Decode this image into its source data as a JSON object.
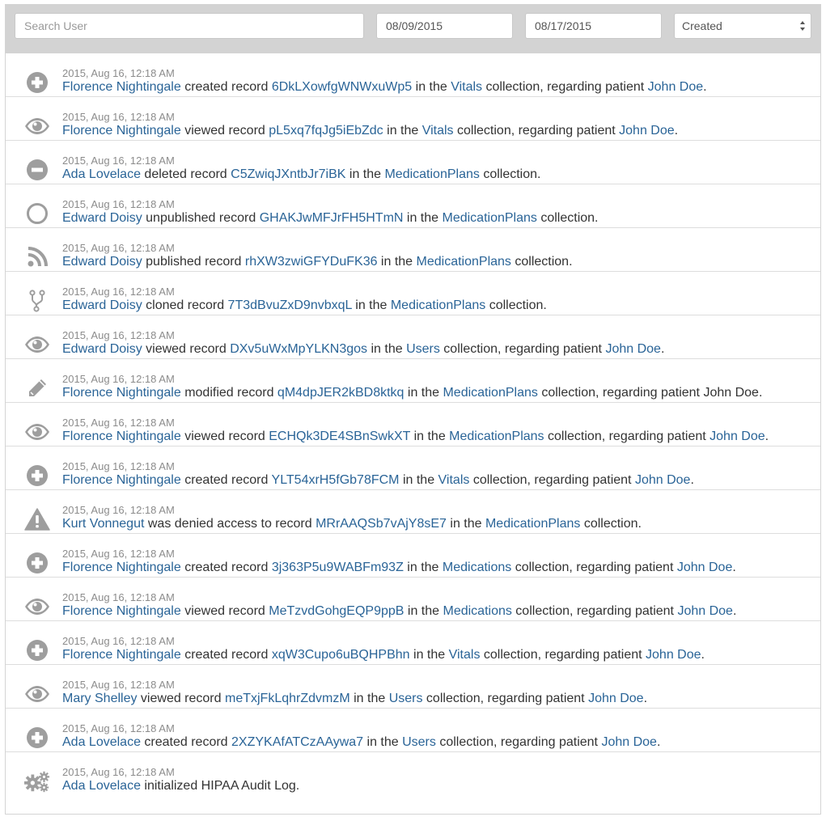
{
  "filters": {
    "search_placeholder": "Search User",
    "date_from": "08/09/2015",
    "date_to": "08/17/2015",
    "sort_selected": "Created"
  },
  "colors": {
    "link": "#2a6497",
    "icon": "#9e9e9e",
    "toolbar_bg": "#d3d3d3",
    "timestamp": "#8c8c8c"
  },
  "entries": [
    {
      "icon": "plus-circle-icon",
      "time": "2015, Aug 16, 12:18 AM",
      "parts": [
        {
          "t": "Florence Nightingale",
          "link": true
        },
        {
          "t": " created record "
        },
        {
          "t": "6DkLXowfgWNWxuWp5",
          "link": true
        },
        {
          "t": " in the "
        },
        {
          "t": "Vitals",
          "link": true
        },
        {
          "t": " collection, regarding patient "
        },
        {
          "t": "John Doe",
          "link": true
        },
        {
          "t": "."
        }
      ]
    },
    {
      "icon": "eye-icon",
      "time": "2015, Aug 16, 12:18 AM",
      "parts": [
        {
          "t": "Florence Nightingale",
          "link": true
        },
        {
          "t": " viewed record "
        },
        {
          "t": "pL5xq7fqJg5iEbZdc",
          "link": true
        },
        {
          "t": " in the "
        },
        {
          "t": "Vitals",
          "link": true
        },
        {
          "t": " collection, regarding patient "
        },
        {
          "t": "John Doe",
          "link": true
        },
        {
          "t": "."
        }
      ]
    },
    {
      "icon": "minus-circle-icon",
      "time": "2015, Aug 16, 12:18 AM",
      "parts": [
        {
          "t": "Ada Lovelace",
          "link": true
        },
        {
          "t": " deleted record "
        },
        {
          "t": "C5ZwiqJXntbJr7iBK",
          "link": true
        },
        {
          "t": " in the "
        },
        {
          "t": "MedicationPlans",
          "link": true
        },
        {
          "t": " collection."
        }
      ]
    },
    {
      "icon": "circle-outline-icon",
      "time": "2015, Aug 16, 12:18 AM",
      "parts": [
        {
          "t": "Edward Doisy",
          "link": true
        },
        {
          "t": " unpublished record "
        },
        {
          "t": "GHAKJwMFJrFH5HTmN",
          "link": true
        },
        {
          "t": " in the "
        },
        {
          "t": "MedicationPlans",
          "link": true
        },
        {
          "t": " collection."
        }
      ]
    },
    {
      "icon": "rss-icon",
      "time": "2015, Aug 16, 12:18 AM",
      "parts": [
        {
          "t": "Edward Doisy",
          "link": true
        },
        {
          "t": " published record "
        },
        {
          "t": "rhXW3zwiGFYDuFK36",
          "link": true
        },
        {
          "t": " in the "
        },
        {
          "t": "MedicationPlans",
          "link": true
        },
        {
          "t": " collection."
        }
      ]
    },
    {
      "icon": "code-fork-icon",
      "time": "2015, Aug 16, 12:18 AM",
      "parts": [
        {
          "t": "Edward Doisy",
          "link": true
        },
        {
          "t": " cloned record "
        },
        {
          "t": "7T3dBvuZxD9nvbxqL",
          "link": true
        },
        {
          "t": " in the "
        },
        {
          "t": "MedicationPlans",
          "link": true
        },
        {
          "t": " collection."
        }
      ]
    },
    {
      "icon": "eye-icon",
      "time": "2015, Aug 16, 12:18 AM",
      "parts": [
        {
          "t": "Edward Doisy",
          "link": true
        },
        {
          "t": " viewed record "
        },
        {
          "t": "DXv5uWxMpYLKN3gos",
          "link": true
        },
        {
          "t": " in the "
        },
        {
          "t": "Users",
          "link": true
        },
        {
          "t": " collection, regarding patient "
        },
        {
          "t": "John Doe",
          "link": true
        },
        {
          "t": "."
        }
      ]
    },
    {
      "icon": "pencil-icon",
      "time": "2015, Aug 16, 12:18 AM",
      "parts": [
        {
          "t": "Florence Nightingale",
          "link": true
        },
        {
          "t": " modified record "
        },
        {
          "t": "qM4dpJER2kBD8ktkq",
          "link": true
        },
        {
          "t": " in the "
        },
        {
          "t": "MedicationPlans",
          "link": true
        },
        {
          "t": " collection, regarding patient John Doe."
        }
      ]
    },
    {
      "icon": "eye-icon",
      "time": "2015, Aug 16, 12:18 AM",
      "parts": [
        {
          "t": "Florence Nightingale",
          "link": true
        },
        {
          "t": " viewed record "
        },
        {
          "t": "ECHQk3DE4SBnSwkXT",
          "link": true
        },
        {
          "t": " in the "
        },
        {
          "t": "MedicationPlans",
          "link": true
        },
        {
          "t": " collection, regarding patient "
        },
        {
          "t": "John Doe",
          "link": true
        },
        {
          "t": "."
        }
      ]
    },
    {
      "icon": "plus-circle-icon",
      "time": "2015, Aug 16, 12:18 AM",
      "parts": [
        {
          "t": "Florence Nightingale",
          "link": true
        },
        {
          "t": " created record "
        },
        {
          "t": "YLT54xrH5fGb78FCM",
          "link": true
        },
        {
          "t": " in the "
        },
        {
          "t": "Vitals",
          "link": true
        },
        {
          "t": " collection, regarding patient "
        },
        {
          "t": "John Doe",
          "link": true
        },
        {
          "t": "."
        }
      ]
    },
    {
      "icon": "warning-icon",
      "time": "2015, Aug 16, 12:18 AM",
      "parts": [
        {
          "t": "Kurt Vonnegut",
          "link": true
        },
        {
          "t": " was denied access to record "
        },
        {
          "t": "MRrAAQSb7vAjY8sE7",
          "link": true
        },
        {
          "t": " in the "
        },
        {
          "t": "MedicationPlans",
          "link": true
        },
        {
          "t": " collection."
        }
      ]
    },
    {
      "icon": "plus-circle-icon",
      "time": "2015, Aug 16, 12:18 AM",
      "parts": [
        {
          "t": "Florence Nightingale",
          "link": true
        },
        {
          "t": " created record "
        },
        {
          "t": "3j363P5u9WABFm93Z",
          "link": true
        },
        {
          "t": " in the "
        },
        {
          "t": "Medications",
          "link": true
        },
        {
          "t": " collection, regarding patient "
        },
        {
          "t": "John Doe",
          "link": true
        },
        {
          "t": "."
        }
      ]
    },
    {
      "icon": "eye-icon",
      "time": "2015, Aug 16, 12:18 AM",
      "parts": [
        {
          "t": "Florence Nightingale",
          "link": true
        },
        {
          "t": " viewed record "
        },
        {
          "t": "MeTzvdGohgEQP9ppB",
          "link": true
        },
        {
          "t": " in the "
        },
        {
          "t": "Medications",
          "link": true
        },
        {
          "t": " collection, regarding patient "
        },
        {
          "t": "John Doe",
          "link": true
        },
        {
          "t": "."
        }
      ]
    },
    {
      "icon": "plus-circle-icon",
      "time": "2015, Aug 16, 12:18 AM",
      "parts": [
        {
          "t": "Florence Nightingale",
          "link": true
        },
        {
          "t": " created record "
        },
        {
          "t": "xqW3Cupo6uBQHPBhn",
          "link": true
        },
        {
          "t": " in the "
        },
        {
          "t": "Vitals",
          "link": true
        },
        {
          "t": " collection, regarding patient "
        },
        {
          "t": "John Doe",
          "link": true
        },
        {
          "t": "."
        }
      ]
    },
    {
      "icon": "eye-icon",
      "time": "2015, Aug 16, 12:18 AM",
      "parts": [
        {
          "t": "Mary Shelley",
          "link": true
        },
        {
          "t": " viewed record "
        },
        {
          "t": "meTxjFkLqhrZdvmzM",
          "link": true
        },
        {
          "t": " in the "
        },
        {
          "t": "Users",
          "link": true
        },
        {
          "t": " collection, regarding patient "
        },
        {
          "t": "John Doe",
          "link": true
        },
        {
          "t": "."
        }
      ]
    },
    {
      "icon": "plus-circle-icon",
      "time": "2015, Aug 16, 12:18 AM",
      "parts": [
        {
          "t": "Ada Lovelace",
          "link": true
        },
        {
          "t": " created record "
        },
        {
          "t": "2XZYKAfATCzAAywa7",
          "link": true
        },
        {
          "t": " in the "
        },
        {
          "t": "Users",
          "link": true
        },
        {
          "t": " collection, regarding patient "
        },
        {
          "t": "John Doe",
          "link": true
        },
        {
          "t": "."
        }
      ]
    },
    {
      "icon": "gears-icon",
      "time": "2015, Aug 16, 12:18 AM",
      "parts": [
        {
          "t": "Ada Lovelace",
          "link": true
        },
        {
          "t": " initialized HIPAA Audit Log."
        }
      ]
    }
  ]
}
